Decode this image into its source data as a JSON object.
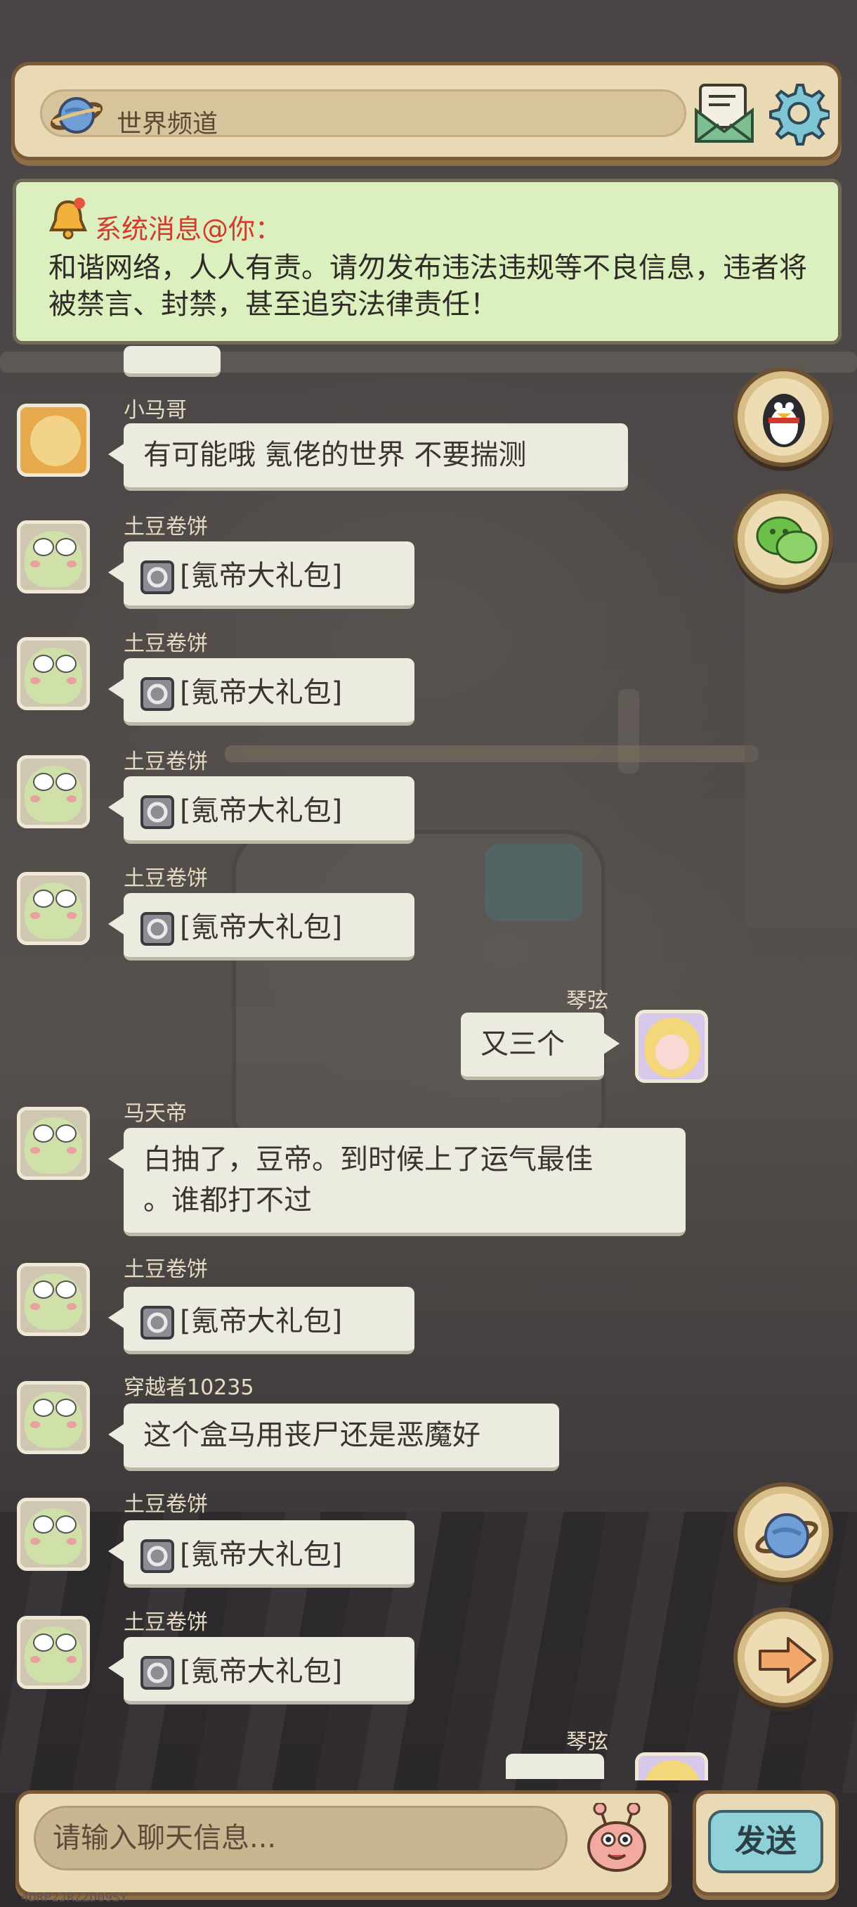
{
  "header": {
    "channel_label": "世界频道"
  },
  "notice": {
    "title": "系统消息@你：",
    "text": "和谐网络，人人有责。请勿发布违法违规等不良信息，违者将被禁言、封禁，甚至追究法律责任！"
  },
  "messages": [
    {
      "user": "小马哥",
      "text": "有可能哦  氪佬的世界  不要揣测",
      "side": "left",
      "avatar": "pony"
    },
    {
      "user": "土豆卷饼",
      "text": "[氪帝大礼包]",
      "side": "left",
      "avatar": "frog",
      "gift": true
    },
    {
      "user": "土豆卷饼",
      "text": "[氪帝大礼包]",
      "side": "left",
      "avatar": "frog",
      "gift": true
    },
    {
      "user": "土豆卷饼",
      "text": "[氪帝大礼包]",
      "side": "left",
      "avatar": "frog",
      "gift": true
    },
    {
      "user": "土豆卷饼",
      "text": "[氪帝大礼包]",
      "side": "left",
      "avatar": "frog",
      "gift": true
    },
    {
      "user": "琴弦",
      "text": "又三个",
      "side": "right",
      "avatar": "girl"
    },
    {
      "user": "马天帝",
      "text_line1": "白抽了，豆帝。到时候上了运气最佳",
      "text_line2": "。谁都打不过",
      "side": "left",
      "avatar": "frog"
    },
    {
      "user": "土豆卷饼",
      "text": "[氪帝大礼包]",
      "side": "left",
      "avatar": "frog",
      "gift": true
    },
    {
      "user": "穿越者10235",
      "text": "这个盒马用丧尸还是恶魔好",
      "side": "left",
      "avatar": "frog"
    },
    {
      "user": "土豆卷饼",
      "text": "[氪帝大礼包]",
      "side": "left",
      "avatar": "frog",
      "gift": true
    },
    {
      "user": "土豆卷饼",
      "text": "[氪帝大礼包]",
      "side": "left",
      "avatar": "frog",
      "gift": true
    },
    {
      "user": "琴弦",
      "text": "",
      "side": "right",
      "avatar": "girl",
      "partial": true
    }
  ],
  "side_buttons": [
    "penguin-icon",
    "wechat-icon",
    "planet-icon",
    "arrow-right-icon"
  ],
  "input": {
    "placeholder": "请输入聊天信息..."
  },
  "send": {
    "label": "发送"
  },
  "footer": {
    "watermark": "4DRP2JRZZD09SY"
  },
  "colors": {
    "accent_red": "#d13c2e",
    "notice_bg": "#dcefbe",
    "panel_bg": "#e9d9b4",
    "send_bg": "#8fd1d8"
  }
}
